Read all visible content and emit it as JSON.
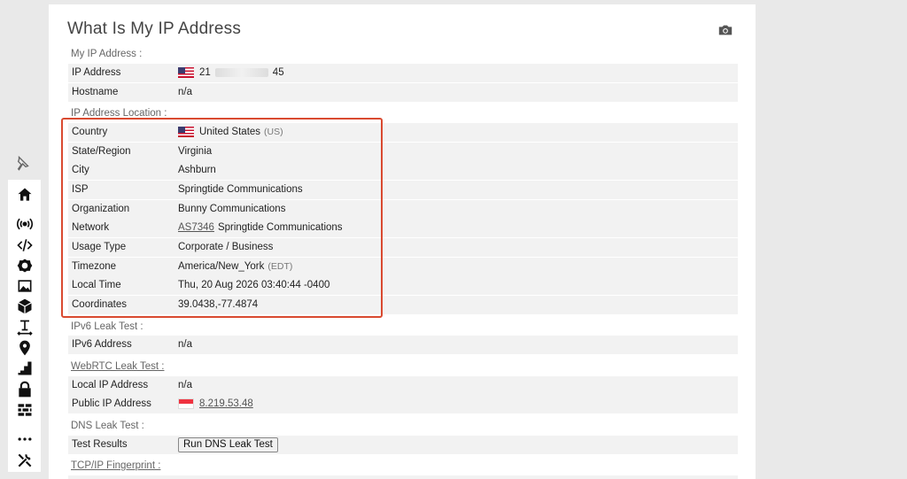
{
  "page": {
    "title": "What Is My IP Address"
  },
  "sections": {
    "my_ip": "My IP Address :",
    "location": "IP Address Location :",
    "ipv6": "IPv6 Leak Test :",
    "webrtc": "WebRTC Leak Test :",
    "dns": "DNS Leak Test :",
    "tcpip": "TCP/IP Fingerprint :"
  },
  "my_ip": {
    "ip_label": "IP Address",
    "ip_prefix": "21",
    "ip_suffix": "45",
    "host_label": "Hostname",
    "host_value": "n/a"
  },
  "location": {
    "country_label": "Country",
    "country_value": "United States",
    "country_code": "(US)",
    "state_label": "State/Region",
    "state_value": "Virginia",
    "city_label": "City",
    "city_value": "Ashburn",
    "isp_label": "ISP",
    "isp_value": "Springtide Communications",
    "org_label": "Organization",
    "org_value": "Bunny Communications",
    "network_label": "Network",
    "network_asn": "AS7346",
    "network_name": "Springtide Communications",
    "usage_label": "Usage Type",
    "usage_value": "Corporate / Business",
    "tz_label": "Timezone",
    "tz_value": "America/New_York",
    "tz_abbr": "(EDT)",
    "time_label": "Local Time",
    "time_value": "Thu, 20 Aug 2026 03:40:44 -0400",
    "coord_label": "Coordinates",
    "coord_value": "39.0438,-77.4874"
  },
  "ipv6": {
    "label": "IPv6 Address",
    "value": "n/a"
  },
  "webrtc": {
    "local_label": "Local IP Address",
    "local_value": "n/a",
    "public_label": "Public IP Address",
    "public_value": "8.219.53.48"
  },
  "dns": {
    "label": "Test Results",
    "button": "Run DNS Leak Test"
  },
  "colors": {
    "highlight": "#d94a30",
    "row_bg": "#f2f2f2"
  }
}
